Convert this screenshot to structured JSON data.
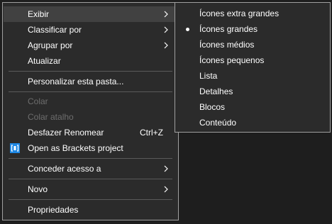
{
  "main_menu": {
    "exibir": "Exibir",
    "classificar": "Classificar por",
    "agrupar": "Agrupar por",
    "atualizar": "Atualizar",
    "personalizar": "Personalizar esta pasta...",
    "colar": "Colar",
    "colar_atalho": "Colar atalho",
    "desfazer": "Desfazer Renomear",
    "desfazer_shortcut": "Ctrl+Z",
    "brackets": "Open as Brackets project",
    "conceder": "Conceder acesso a",
    "novo": "Novo",
    "propriedades": "Propriedades"
  },
  "sub_menu": {
    "items": [
      {
        "label": "Ícones extra grandes",
        "selected": false
      },
      {
        "label": "Ícones grandes",
        "selected": true
      },
      {
        "label": "Ícones médios",
        "selected": false
      },
      {
        "label": "Ícones pequenos",
        "selected": false
      },
      {
        "label": "Lista",
        "selected": false
      },
      {
        "label": "Detalhes",
        "selected": false
      },
      {
        "label": "Blocos",
        "selected": false
      },
      {
        "label": "Conteúdo",
        "selected": false
      }
    ]
  },
  "icons": {
    "submenu_arrow": "chevron-right-icon",
    "brackets": "brackets-icon",
    "radio": "bullet-icon"
  },
  "colors": {
    "menu_bg": "#2b2b2b",
    "hover_bg": "#414141",
    "border": "#a0a0a0",
    "text": "#ffffff",
    "disabled_text": "#6d6d6d",
    "brackets_blue": "#1e88e5"
  }
}
